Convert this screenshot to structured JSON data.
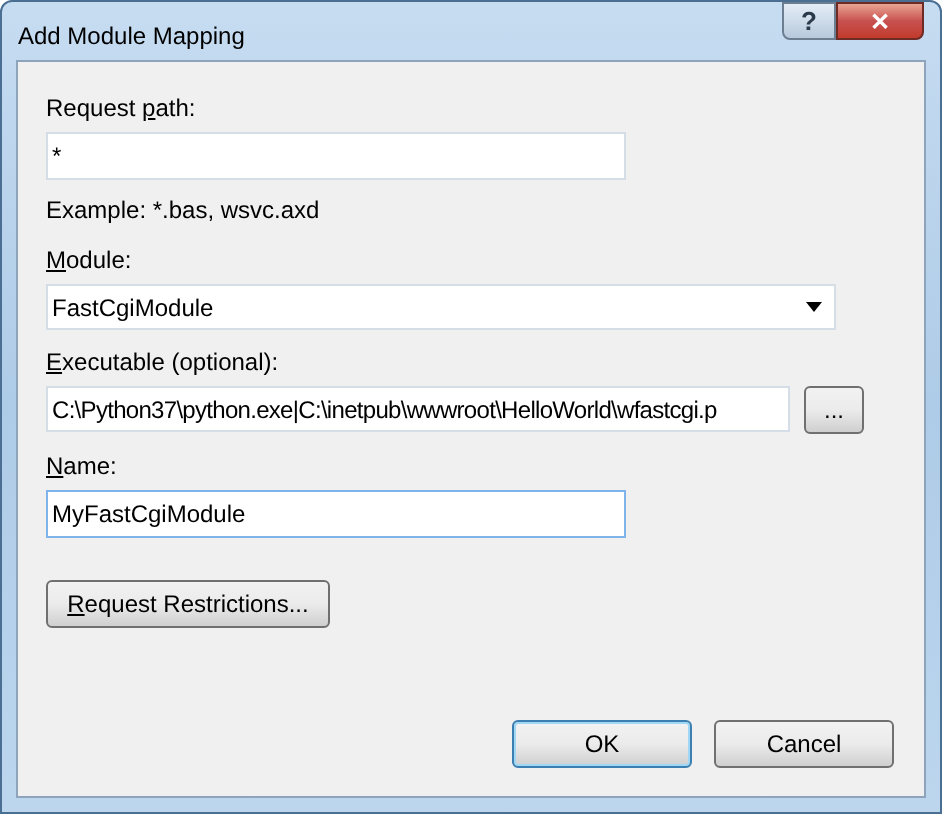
{
  "window": {
    "title": "Add Module Mapping",
    "buttons": [
      "?",
      "✕"
    ]
  },
  "fields": [
    {
      "kind": "text",
      "label": {
        "pre": "Request ",
        "key": "p",
        "post": "ath:"
      },
      "value": "*",
      "focused": false,
      "hint": "Example: *.bas, wsvc.axd"
    },
    {
      "kind": "select",
      "label": {
        "key": "M",
        "post": "odule:"
      },
      "value": "FastCgiModule",
      "focused": false
    },
    {
      "kind": "browse",
      "label": {
        "key": "E",
        "post": "xecutable (optional):"
      },
      "value": "C:\\Python37\\python.exe|C:\\inetpub\\wwwroot\\HelloWorld\\wfastcgi.p",
      "focused": false,
      "button": "..."
    },
    {
      "kind": "text",
      "label": {
        "key": "N",
        "post": "ame:"
      },
      "value": "MyFastCgiModule",
      "focused": true
    }
  ],
  "restrictions_button": {
    "key": "R",
    "post": "equest Restrictions..."
  },
  "buttons": [
    {
      "label": "OK",
      "default": true
    },
    {
      "label": "Cancel",
      "default": false
    }
  ]
}
